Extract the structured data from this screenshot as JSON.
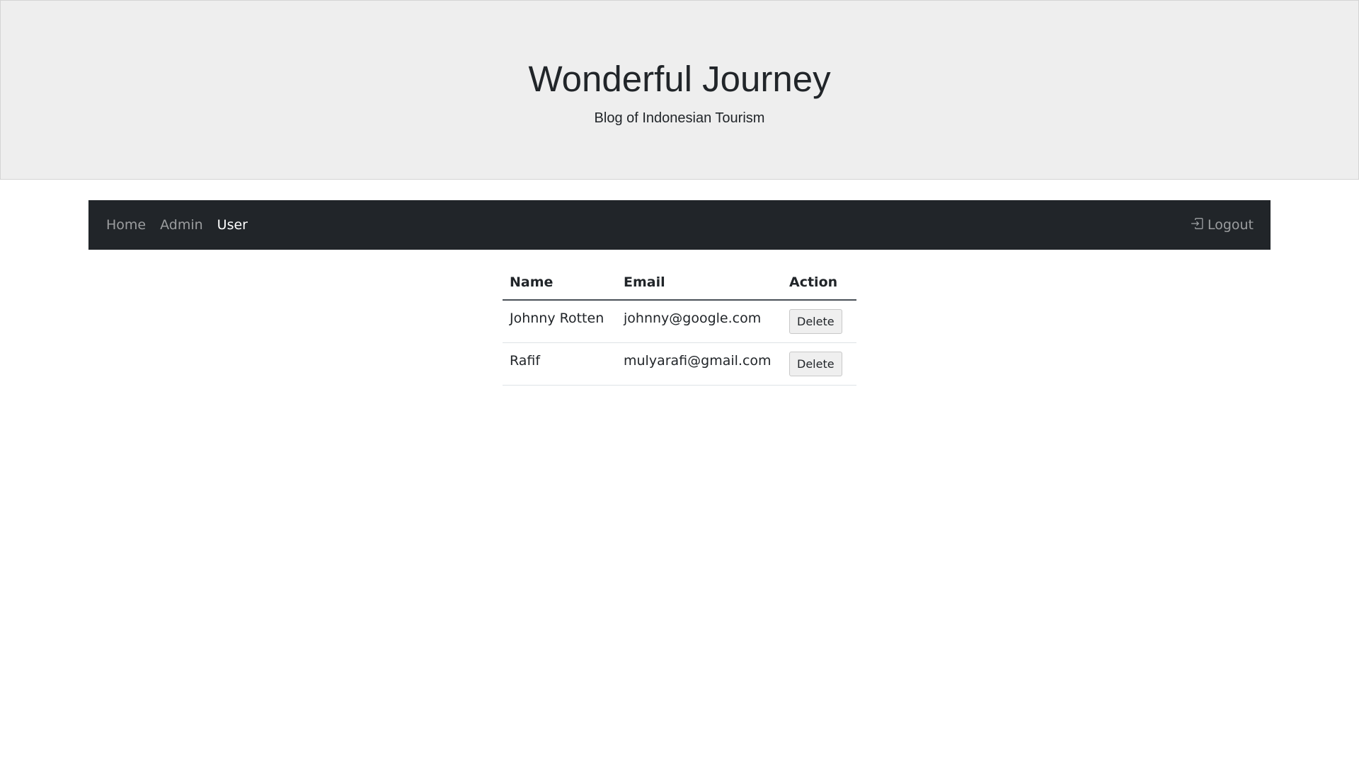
{
  "header": {
    "title": "Wonderful Journey",
    "subtitle": "Blog of Indonesian Tourism"
  },
  "navbar": {
    "items": [
      {
        "label": "Home",
        "active": false
      },
      {
        "label": "Admin",
        "active": false
      },
      {
        "label": "User",
        "active": true
      }
    ],
    "logout_label": "Logout",
    "logout_icon": "box-arrow-in-right-icon"
  },
  "users_table": {
    "columns": [
      "Name",
      "Email",
      "Action"
    ],
    "rows": [
      {
        "name": "Johnny Rotten",
        "email": "johnny@google.com",
        "action": "Delete"
      },
      {
        "name": "Rafif",
        "email": "mulyarafi@gmail.com",
        "action": "Delete"
      }
    ]
  },
  "colors": {
    "jumbotron_bg": "#eeeeee",
    "navbar_bg": "#212529",
    "nav_inactive": "#9a9da0",
    "nav_active": "#ffffff"
  }
}
